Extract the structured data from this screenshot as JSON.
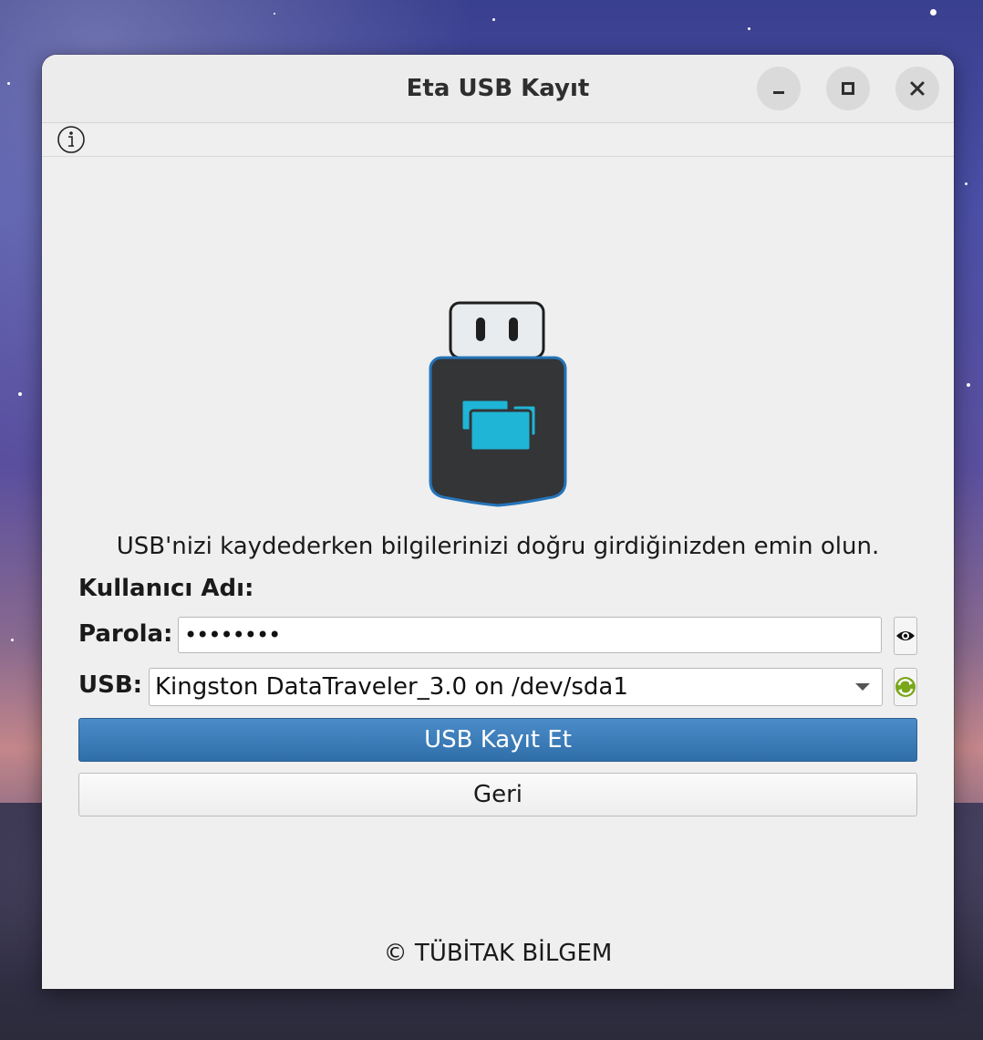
{
  "window": {
    "title": "Eta USB Kayıt",
    "controls": {
      "minimize_icon": "minimize-icon",
      "maximize_icon": "maximize-icon",
      "close_icon": "close-icon"
    }
  },
  "menubar": {
    "info_icon": "info-icon"
  },
  "hero": {
    "icon": "usb-drive-icon",
    "accent_color": "#1fb5d6"
  },
  "form": {
    "message": "USB'nizi kaydederken bilgilerinizi doğru girdiğinizden emin olun.",
    "username_label": "Kullanıcı Adı:",
    "password_label": "Parola:",
    "password_value": "••••••••",
    "usb_label": "USB:",
    "usb_selected": "Kingston DataTraveler_3.0 on /dev/sda1",
    "show_password_icon": "eye-icon",
    "refresh_icon": "refresh-icon"
  },
  "buttons": {
    "register": "USB Kayıt Et",
    "back": "Geri",
    "primary_color": "#3a7cbd"
  },
  "footer": {
    "copyright": "© TÜBİTAK BİLGEM"
  }
}
